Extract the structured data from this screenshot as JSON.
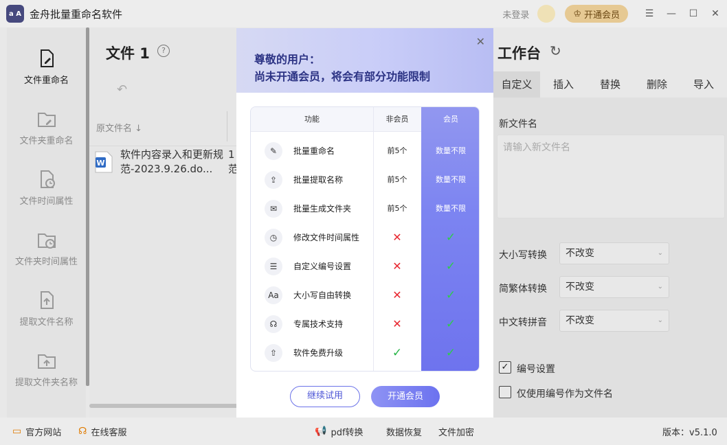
{
  "app": {
    "logo_text": "a A",
    "title": "金舟批量重命名软件",
    "login": "未登录",
    "vip_button": "开通会员"
  },
  "sidebar": {
    "items": [
      {
        "label": "文件重命名",
        "active": true
      },
      {
        "label": "文件夹重命名"
      },
      {
        "label": "文件时间属性"
      },
      {
        "label": "文件夹时间属性"
      },
      {
        "label": "提取文件名称"
      },
      {
        "label": "提取文件夹名称"
      }
    ]
  },
  "files": {
    "title": "文件 1",
    "help": "?",
    "column_name": "原文件名 ↓",
    "rows": [
      {
        "name": "软件内容录入和更新规范-2023.9.26.do...",
        "extra_1": "1",
        "extra_2": "范"
      }
    ]
  },
  "workbench": {
    "title": "工作台",
    "tabs": [
      "自定义",
      "插入",
      "替换",
      "删除",
      "导入"
    ],
    "new_name_label": "新文件名",
    "new_name_placeholder": "请输入新文件名",
    "case_label": "大小写转换",
    "case_value": "不改变",
    "trad_label": "简繁体转换",
    "trad_value": "不改变",
    "pinyin_label": "中文转拼音",
    "pinyin_value": "不改变",
    "numbering_label": "编号设置",
    "only_number_label": "仅使用编号作为文件名"
  },
  "bottom": {
    "website": "官方网站",
    "service": "在线客服",
    "pdf": "pdf转换",
    "recover": "数据恢复",
    "encrypt": "文件加密",
    "version": "版本：v5.1.0"
  },
  "modal": {
    "line1": "尊敬的用户：",
    "line2": "尚未开通会员，将会有部分功能限制",
    "col_feature": "功能",
    "col_free": "非会员",
    "col_vip": "会员",
    "features": [
      {
        "name": "批量重命名",
        "free": "前5个",
        "vip": "数量不限"
      },
      {
        "name": "批量提取名称",
        "free": "前5个",
        "vip": "数量不限"
      },
      {
        "name": "批量生成文件夹",
        "free": "前5个",
        "vip": "数量不限"
      },
      {
        "name": "修改文件时间属性",
        "free": "✕",
        "vip": "✓"
      },
      {
        "name": "自定义编号设置",
        "free": "✕",
        "vip": "✓"
      },
      {
        "name": "大小写自由转换",
        "free": "✕",
        "vip": "✓"
      },
      {
        "name": "专属技术支持",
        "free": "✕",
        "vip": "✓"
      },
      {
        "name": "软件免费升级",
        "free": "✓",
        "vip": "✓"
      }
    ],
    "try_button": "继续试用",
    "vip_button": "开通会员"
  },
  "colors": {
    "accent": "#6c72ef",
    "header_text": "#2c3384",
    "deny": "#e8262f",
    "allow": "#27b547"
  }
}
